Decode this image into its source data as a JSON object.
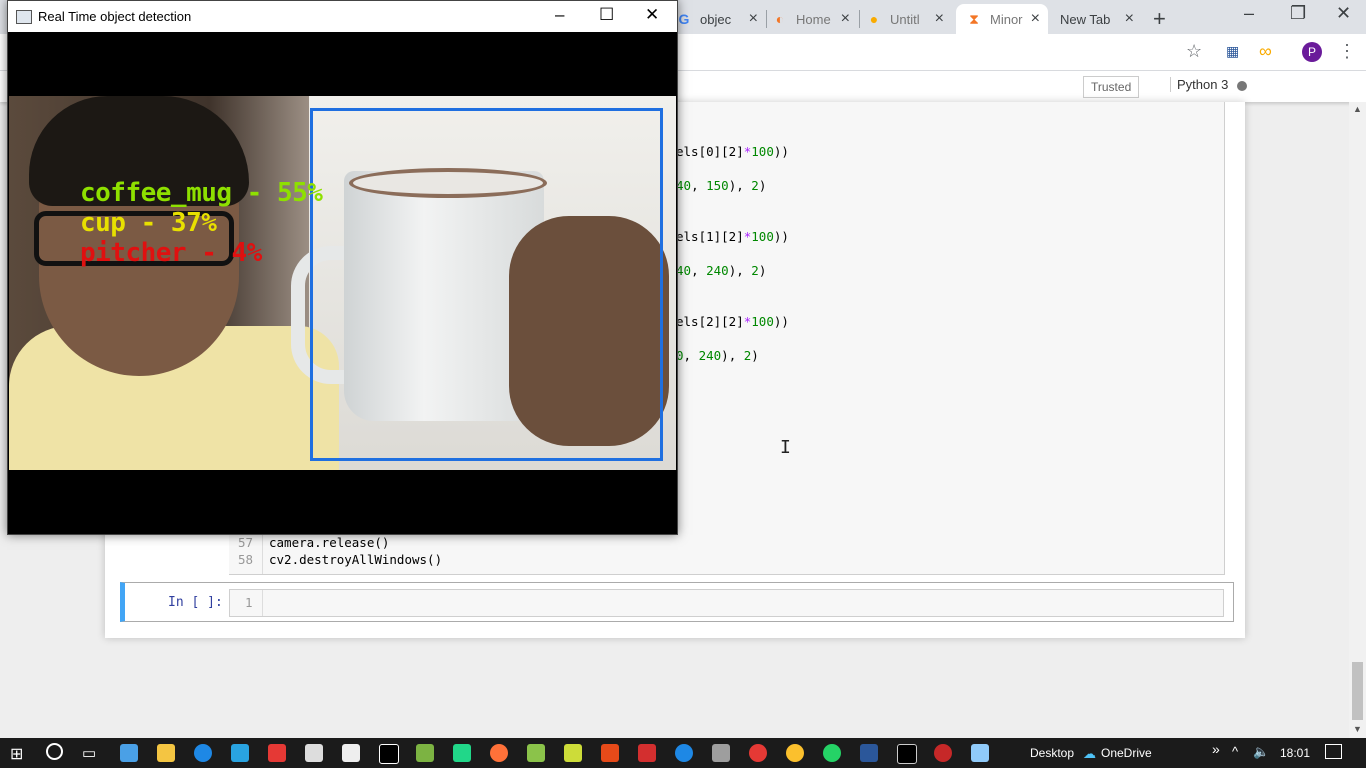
{
  "browser": {
    "tabs": [
      {
        "label": "objec",
        "favicon": "google-icon",
        "active": false
      },
      {
        "label": "Home",
        "favicon": "jupyter-icon",
        "active": false
      },
      {
        "label": "Untitl",
        "favicon": "colab-icon",
        "active": false
      },
      {
        "label": "Minor",
        "favicon": "hourglass-icon",
        "active": true
      },
      {
        "label": "New Tab",
        "favicon": "",
        "active": false
      }
    ],
    "new_tab_symbol": "+",
    "profile_initial": "P"
  },
  "jupyter": {
    "trusted_label": "Trusted",
    "kernel_label": "Python 3",
    "code_lines_visible": [
      {
        "text_parts": [
          {
            "t": "els[0][2]",
            "c": ""
          },
          {
            "t": "*",
            "c": "op"
          },
          {
            "t": "100",
            "c": "num"
          },
          {
            "t": "))",
            "c": ""
          }
        ]
      },
      {
        "text_parts": [
          {
            "t": "40",
            "c": "num"
          },
          {
            "t": ", ",
            "c": ""
          },
          {
            "t": "150",
            "c": "num"
          },
          {
            "t": "), ",
            "c": ""
          },
          {
            "t": "2",
            "c": "num"
          },
          {
            "t": ")",
            "c": ""
          }
        ]
      },
      {
        "text_parts": [
          {
            "t": "els[1][2]",
            "c": ""
          },
          {
            "t": "*",
            "c": "op"
          },
          {
            "t": "100",
            "c": "num"
          },
          {
            "t": "))",
            "c": ""
          }
        ]
      },
      {
        "text_parts": [
          {
            "t": "40",
            "c": "num"
          },
          {
            "t": ", ",
            "c": ""
          },
          {
            "t": "240",
            "c": "num"
          },
          {
            "t": "), ",
            "c": ""
          },
          {
            "t": "2",
            "c": "num"
          },
          {
            "t": ")",
            "c": ""
          }
        ]
      },
      {
        "text_parts": [
          {
            "t": "els[2][2]",
            "c": ""
          },
          {
            "t": "*",
            "c": "op"
          },
          {
            "t": "100",
            "c": "num"
          },
          {
            "t": "))",
            "c": ""
          }
        ]
      },
      {
        "text_parts": [
          {
            "t": "0",
            "c": "num"
          },
          {
            "t": ", ",
            "c": ""
          },
          {
            "t": "240",
            "c": "num"
          },
          {
            "t": "), ",
            "c": ""
          },
          {
            "t": "2",
            "c": "num"
          },
          {
            "t": ")",
            "c": ""
          }
        ]
      }
    ],
    "line57_num": "57",
    "line57_text": "camera.release()",
    "line58_num": "58",
    "line58_text": "cv2.destroyAllWindows()",
    "empty_cell_prompt": "In [ ]:",
    "empty_cell_line_num": "1"
  },
  "cv_window": {
    "title": "Real Time object detection",
    "detections": [
      {
        "label": "coffee_mug - 55%",
        "color": "#8ee000"
      },
      {
        "label": "cup - 37%",
        "color": "#e8e000"
      },
      {
        "label": "pitcher - 4%",
        "color": "#e01010"
      }
    ],
    "box_color": "#1f6fe0"
  },
  "taskbar": {
    "desktop_label": "Desktop",
    "onedrive_label": "OneDrive",
    "time": "18:01",
    "overflow_symbol": "»"
  }
}
